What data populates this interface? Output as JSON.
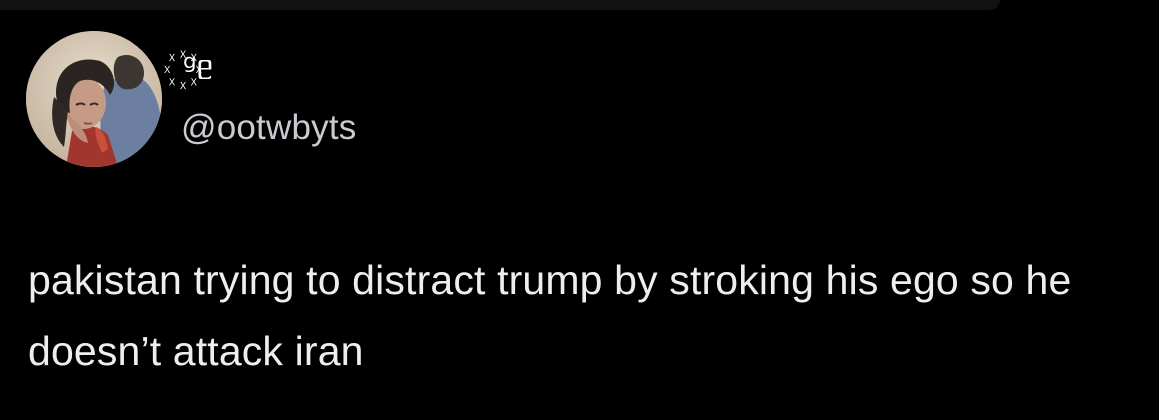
{
  "colors": {
    "background": "#000000",
    "text_primary": "#eceeef",
    "text_secondary": "#c8ccd0"
  },
  "author": {
    "display_name": "꙰ᵍᥱ",
    "handle": "@ootwbyts",
    "avatar_icon": "profile-photo"
  },
  "tweet": {
    "text": "pakistan trying to distract trump by stroking his ego so he doesn’t attack iran"
  }
}
